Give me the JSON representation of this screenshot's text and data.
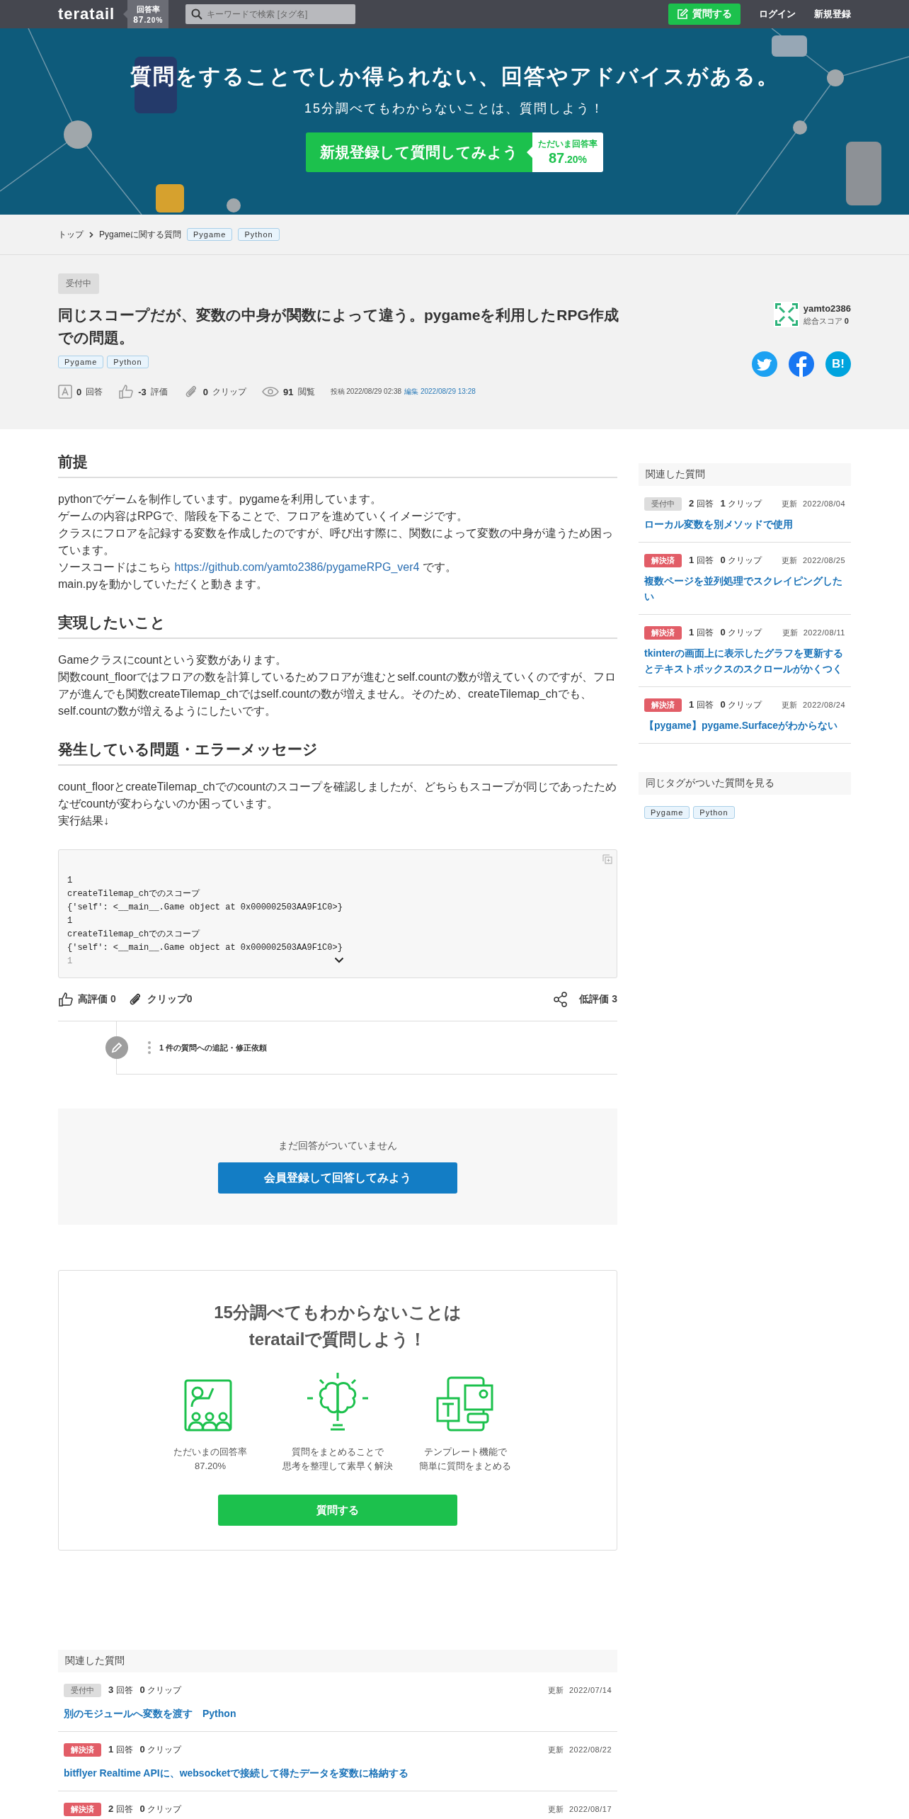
{
  "header": {
    "logo": "teratail",
    "rate_label": "回答率",
    "rate_whole": "87",
    "rate_fraction": ".20%",
    "search_placeholder": "キーワードで検索 [タグ名]",
    "ask_button": "質問する",
    "login": "ログイン",
    "signup": "新規登録"
  },
  "hero": {
    "title": "質問をすることでしか得られない、回答やアドバイスがある。",
    "subtitle": "15分調べてもわからないことは、質問しよう！",
    "cta": "新規登録して質問してみよう",
    "rate_label": "ただいま回答率",
    "rate_whole": "87",
    "rate_fraction": ".20%"
  },
  "breadcrumb": {
    "items": [
      "トップ",
      "Pygameに関する質問"
    ],
    "tags": [
      "Pygame",
      "Python"
    ]
  },
  "question": {
    "status": "受付中",
    "title": "同じスコープだが、変数の中身が関数によって違う。pygameを利用したRPG作成での問題。",
    "tags": [
      "Pygame",
      "Python"
    ],
    "stats": [
      {
        "kind": "answers",
        "value": "0",
        "label": "回答"
      },
      {
        "kind": "score",
        "value": "-3",
        "label": "評価"
      },
      {
        "kind": "clips",
        "value": "0",
        "label": "クリップ"
      },
      {
        "kind": "views",
        "value": "91",
        "label": "閲覧"
      }
    ],
    "posted_label": "投稿",
    "posted": "2022/08/29 02:38",
    "edited": "編集 2022/08/29 13:28",
    "user": {
      "name": "yamto2386",
      "score_label": "総合スコア",
      "score": "0"
    },
    "hatena": "B!"
  },
  "body": {
    "sections": [
      {
        "heading": "前提",
        "lines": [
          {
            "text": "pythonでゲームを制作しています。pygameを利用しています。"
          },
          {
            "text": "ゲームの内容はRPGで、階段を下ることで、フロアを進めていくイメージです。"
          },
          {
            "text": "クラスにフロアを記録する変数を作成したのですが、呼び出す際に、関数によって変数の中身が違うため困っています。"
          },
          {
            "text": "ソースコードはこちら",
            "link": "https://github.com/yamto2386/pygameRPG_ver4",
            "tail": "です。"
          },
          {
            "text": "main.pyを動かしていただくと動きます。"
          }
        ]
      },
      {
        "heading": "実現したいこと",
        "lines": [
          {
            "text": "Gameクラスにcountという変数があります。"
          },
          {
            "text": "関数count_floorではフロアの数を計算しているためフロアが進むとself.countの数が増えていくのですが、フロアが進んでも関数createTilemap_chではself.countの数が増えません。そのため、createTilemap_chでも、self.countの数が増えるようにしたいです。"
          }
        ]
      },
      {
        "heading": "発生している問題・エラーメッセージ",
        "lines": [
          {
            "text": "count_floorとcreateTilemap_chでのcountのスコープを確認しましたが、どちらもスコープが同じであったためなぜcountが変わらないのか困っています。"
          },
          {
            "text": "実行結果↓"
          }
        ]
      }
    ],
    "code": [
      "1",
      "createTilemap_chでのスコープ",
      "{'self': <__main__.Game object at 0x000002503AA9F1C0>}",
      "1",
      "createTilemap_chでのスコープ",
      "{'self': <__main__.Game object at 0x000002503AA9F1C0>}"
    ],
    "code_faded": "1"
  },
  "actions": {
    "like": "高評価 0",
    "clip": "クリップ0",
    "dislike": "低評価 3",
    "edit_request": "1 件の質問への追記・修正依頼"
  },
  "no_answer": {
    "message": "まだ回答がついていません",
    "button": "会員登録して回答してみよう"
  },
  "cta": {
    "title_lines": [
      "15分調べてもわからないことは",
      "teratailで質問しよう！"
    ],
    "features": [
      {
        "kind": "rate",
        "lines": [
          "ただいまの回答率",
          "87.20%"
        ]
      },
      {
        "kind": "brain",
        "lines": [
          "質問をまとめることで",
          "思考を整理して素早く解決"
        ]
      },
      {
        "kind": "template",
        "lines": [
          "テンプレート機能で",
          "簡単に質問をまとめる"
        ]
      }
    ],
    "button": "質問する"
  },
  "sidebar": {
    "related_title": "関連した質問",
    "related": [
      {
        "status": "受付中",
        "kind": "open",
        "answers": "2",
        "answers_label": "回答",
        "clips": "1",
        "clips_label": "クリップ",
        "updated_label": "更新",
        "updated": "2022/08/04",
        "title": "ローカル変数を別メソッドで使用"
      },
      {
        "status": "解決済",
        "kind": "solved",
        "answers": "1",
        "answers_label": "回答",
        "clips": "0",
        "clips_label": "クリップ",
        "updated_label": "更新",
        "updated": "2022/08/25",
        "title": "複数ページを並列処理でスクレイピングしたい"
      },
      {
        "status": "解決済",
        "kind": "solved",
        "answers": "1",
        "answers_label": "回答",
        "clips": "0",
        "clips_label": "クリップ",
        "updated_label": "更新",
        "updated": "2022/08/11",
        "title": "tkinterの画面上に表示したグラフを更新するとテキストボックスのスクロールがかくつく"
      },
      {
        "status": "解決済",
        "kind": "solved",
        "answers": "1",
        "answers_label": "回答",
        "clips": "0",
        "clips_label": "クリップ",
        "updated_label": "更新",
        "updated": "2022/08/24",
        "title": "【pygame】pygame.Surfaceがわからない"
      }
    ],
    "tags_title": "同じタグがついた質問を見る",
    "tags": [
      "Pygame",
      "Python"
    ]
  },
  "bottom_related": {
    "title": "関連した質問",
    "items": [
      {
        "status": "受付中",
        "kind": "open",
        "answers": "3",
        "answers_label": "回答",
        "clips": "0",
        "clips_label": "クリップ",
        "updated_label": "更新",
        "updated": "2022/07/14",
        "title": "別のモジュールへ変数を渡す　Python"
      },
      {
        "status": "解決済",
        "kind": "solved",
        "answers": "1",
        "answers_label": "回答",
        "clips": "0",
        "clips_label": "クリップ",
        "updated_label": "更新",
        "updated": "2022/08/22",
        "title": "bitflyer Realtime APIに、websocketで接続して得たデータを変数に格納する"
      },
      {
        "status": "解決済",
        "kind": "solved",
        "answers": "2",
        "answers_label": "回答",
        "clips": "0",
        "clips_label": "クリップ",
        "updated_label": "更新",
        "updated": "2022/08/17"
      }
    ]
  }
}
